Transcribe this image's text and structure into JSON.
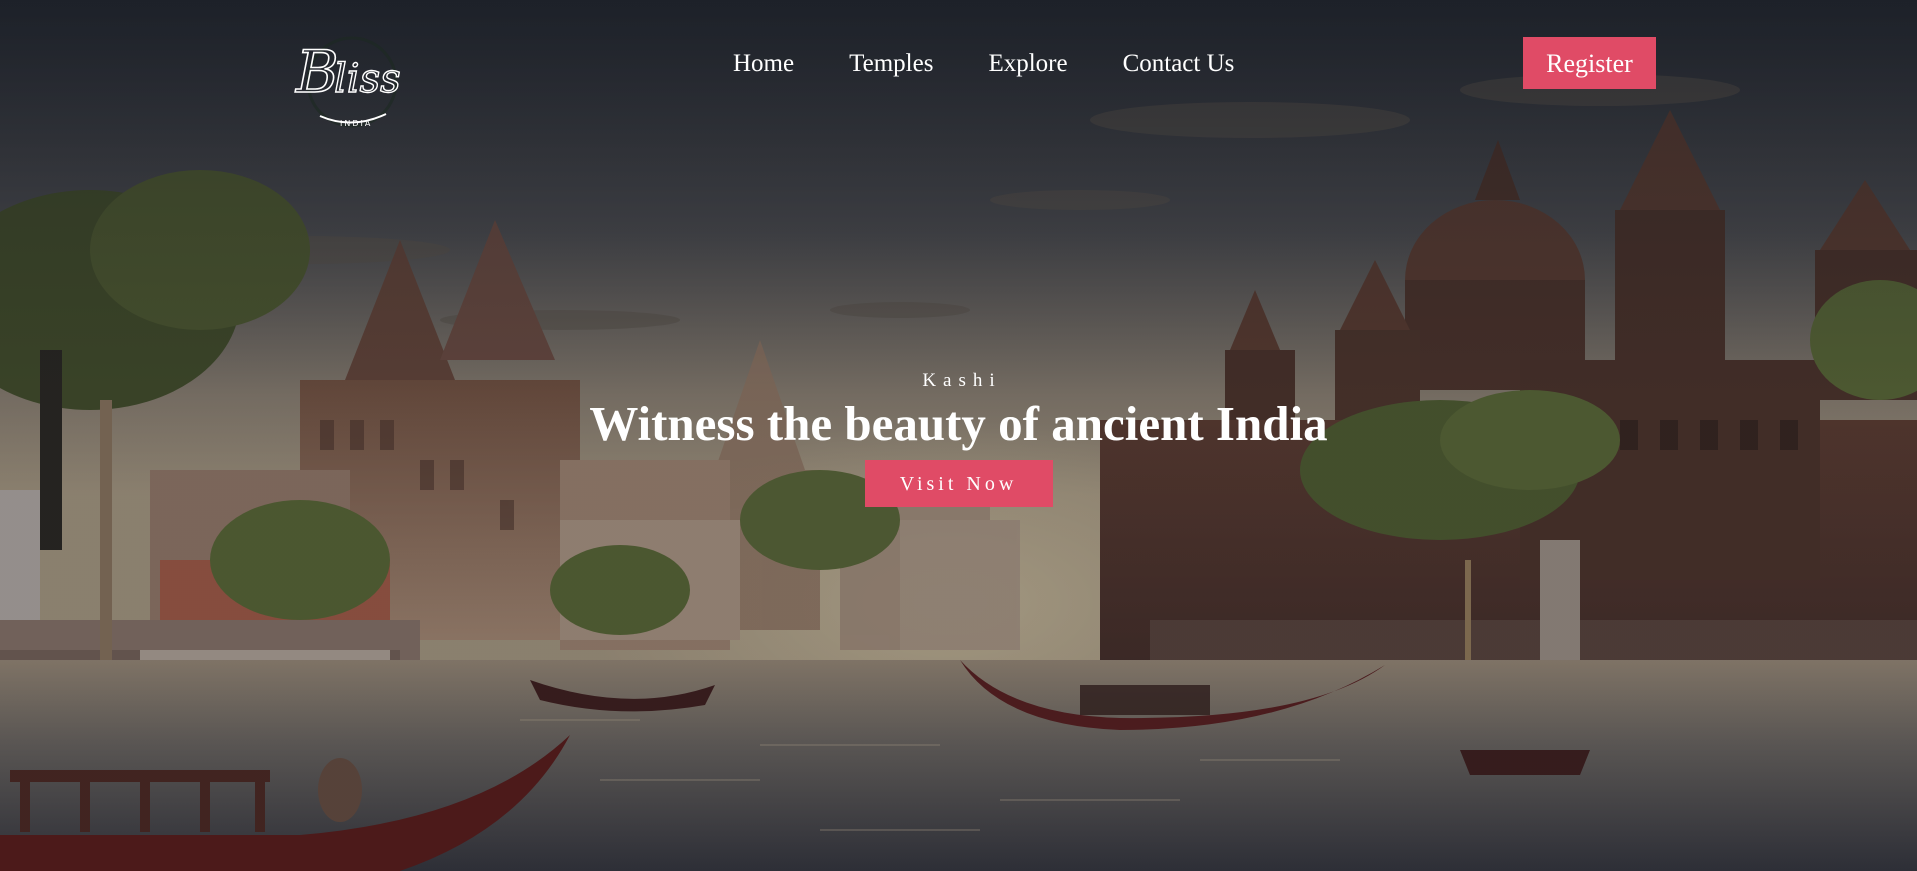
{
  "colors": {
    "accent": "#e04b66",
    "text": "#ffffff",
    "overlay": "#12161e"
  },
  "brand": {
    "logo_script": "Bliss",
    "logo_sub": "INDIA"
  },
  "nav": {
    "items": [
      {
        "label": "Home"
      },
      {
        "label": "Temples"
      },
      {
        "label": "Explore"
      },
      {
        "label": "Contact Us"
      }
    ],
    "register_label": "Register"
  },
  "hero": {
    "eyebrow": "Kashi",
    "headline": "Witness the beauty of ancient India",
    "cta_label": "Visit Now",
    "background": "ghats-temples-river-boats-illustration"
  }
}
